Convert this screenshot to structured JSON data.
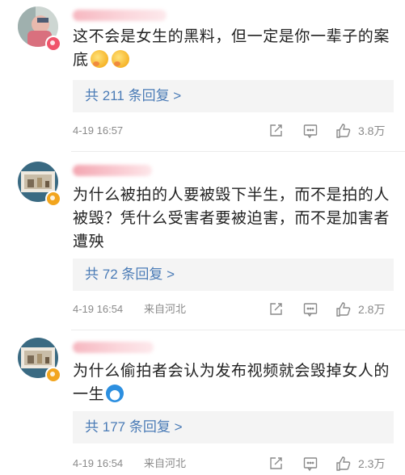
{
  "comments": [
    {
      "text": "这不会是女生的黑料，但一定是你一辈子的案底",
      "emojis": [
        "hug-emoji",
        "hug-emoji"
      ],
      "replies_prefix": "共",
      "replies_count": "211",
      "replies_suffix": "条回复 >",
      "time": "4-19 16:57",
      "source": "",
      "likes": "3.8万",
      "badge_color": "#f0546b"
    },
    {
      "text": "为什么被拍的人要被毁下半生，而不是拍的人被毁？凭什么受害者要被迫害，而不是加害者遭殃",
      "emojis": [],
      "replies_prefix": "共",
      "replies_count": "72",
      "replies_suffix": "条回复 >",
      "time": "4-19 16:54",
      "source": "来自河北",
      "likes": "2.8万",
      "badge_color": "#f2a51e"
    },
    {
      "text": "为什么偷拍者会认为发布视频就会毁掉女人的一生",
      "emojis": [
        "doraemon-emoji"
      ],
      "replies_prefix": "共",
      "replies_count": "177",
      "replies_suffix": "条回复 >",
      "time": "4-19 16:54",
      "source": "来自河北",
      "likes": "2.3万",
      "badge_color": "#f2a51e"
    }
  ],
  "colors": {
    "link": "#4a7bb6",
    "reply_bg": "#f4f4f4",
    "meta": "#8a8a8a"
  },
  "icons": [
    "share-icon",
    "comment-icon",
    "like-icon"
  ]
}
